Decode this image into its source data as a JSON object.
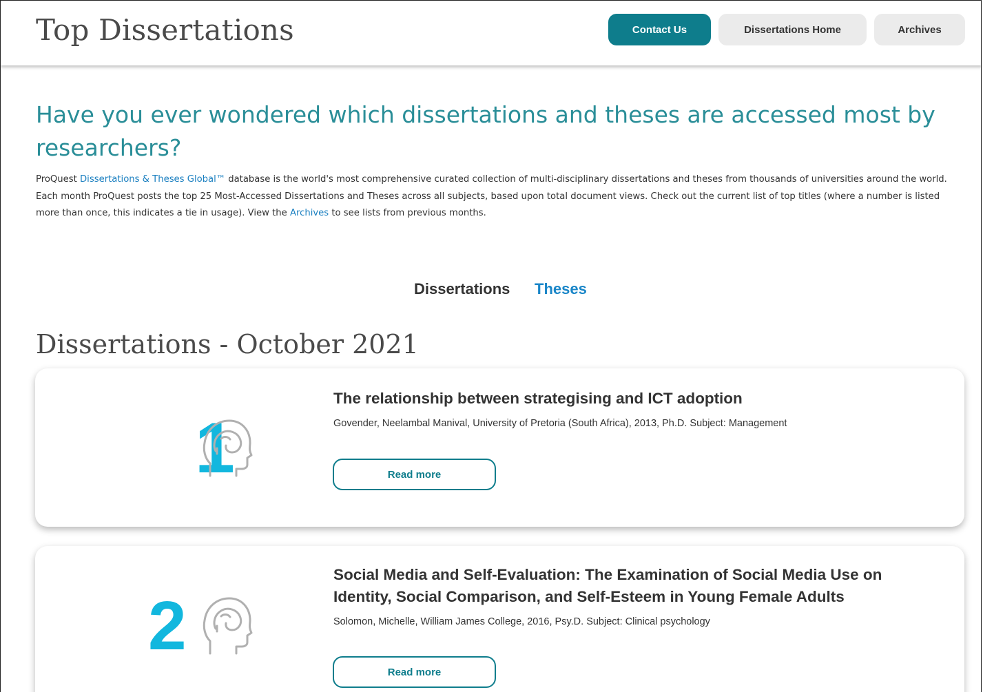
{
  "header": {
    "title": "Top Dissertations",
    "nav": {
      "contact": "Contact Us",
      "home": "Dissertations Home",
      "archives": "Archives"
    }
  },
  "intro": {
    "heading": "Have you ever wondered which dissertations and theses are accessed most by researchers?",
    "text_prefix": "ProQuest ",
    "link_database": "Dissertations & Theses Global™",
    "text_middle": " database is the world's most comprehensive curated collection of multi-disciplinary dissertations and theses from thousands of universities around the world.  Each month ProQuest posts the top 25 Most-Accessed Dissertations and Theses across all subjects, based upon total document views. Check out the current list of top titles (where a number is listed more than once, this indicates a tie in usage). View the ",
    "link_archives": "Archives",
    "text_suffix": " to see lists from previous months."
  },
  "tabs": {
    "dissertations": "Dissertations",
    "theses": "Theses"
  },
  "section_title": "Dissertations - October 2021",
  "items": [
    {
      "rank": "1",
      "title": "The relationship between strategising and ICT adoption",
      "meta": "Govender, Neelambal Manival, University of Pretoria (South Africa), 2013, Ph.D. Subject: Management",
      "button": "Read more",
      "icon": "head-outline-icon"
    },
    {
      "rank": "2",
      "title": "Social Media and Self-Evaluation: The Examination of Social Media Use on Identity, Social Comparison, and Self-Esteem in Young Female Adults",
      "meta": "Solomon, Michelle, William James College, 2016, Psy.D. Subject: Clinical psychology",
      "button": "Read more",
      "icon": "head-outline-icon"
    }
  ],
  "colors": {
    "accent_teal": "#0e7d8c",
    "heading_teal": "#2a8e98",
    "rank_cyan": "#12b7de",
    "link_blue": "#1a7fc0",
    "tab_active_blue": "#1a86c8",
    "icon_gray": "#b0b0b0"
  }
}
